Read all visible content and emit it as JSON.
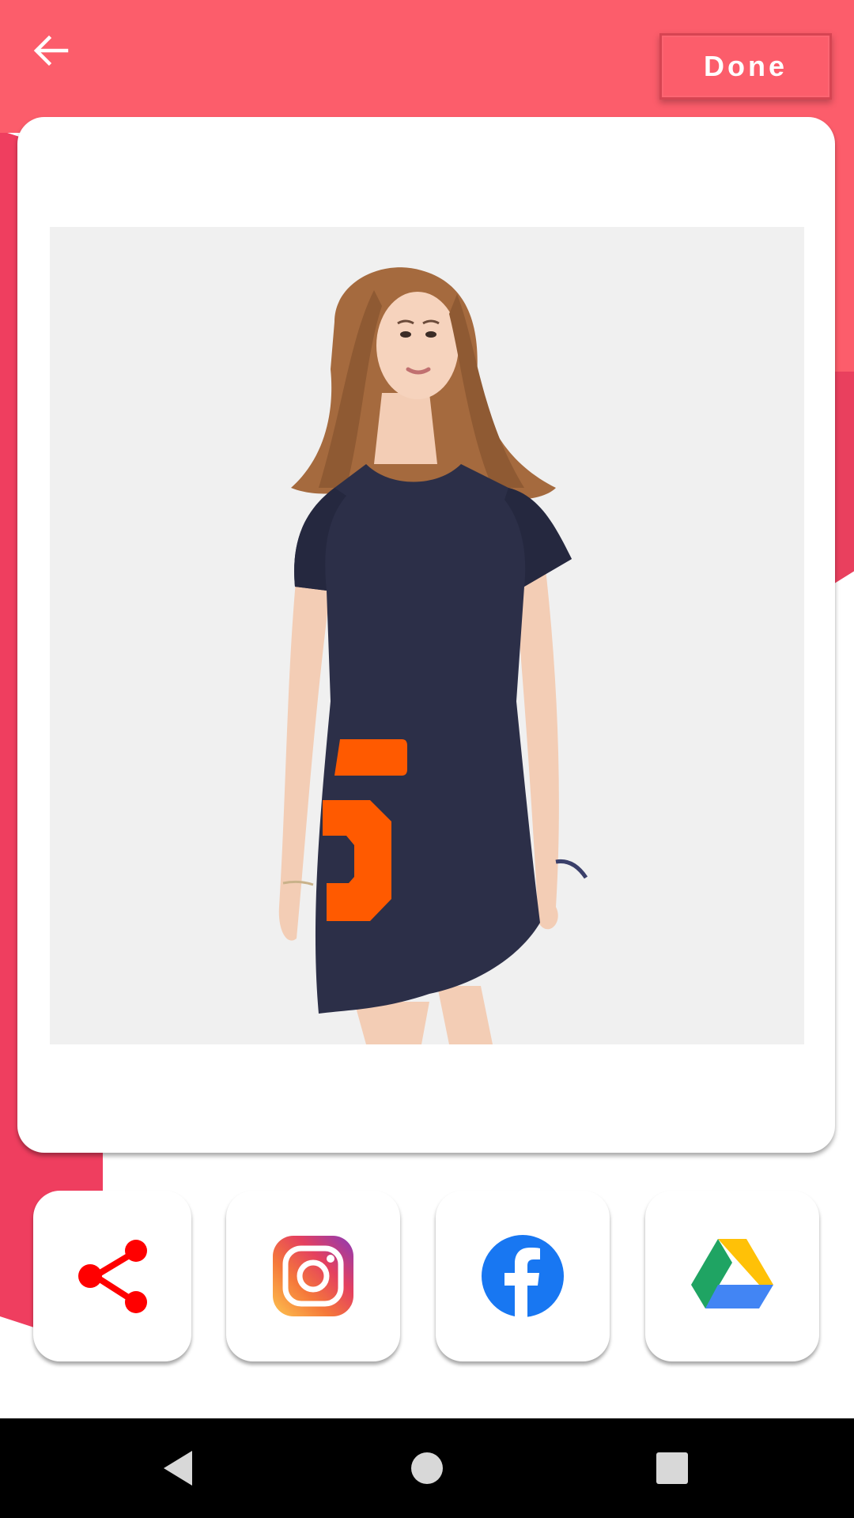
{
  "header": {
    "back_icon": "arrow-left-icon",
    "done_label": "Done"
  },
  "colors": {
    "primary": "#fc5d6b",
    "primary_dark": "#ef3e5f",
    "share_red": "#ff0000",
    "facebook_blue": "#1877f2",
    "dress_navy": "#2c2f48",
    "number_orange": "#ff5a00"
  },
  "preview": {
    "subject": "model-wearing-navy-tshirt-dress",
    "print_text": "5"
  },
  "share": [
    {
      "id": "share",
      "icon": "share-icon"
    },
    {
      "id": "instagram",
      "icon": "instagram-icon"
    },
    {
      "id": "facebook",
      "icon": "facebook-icon"
    },
    {
      "id": "drive",
      "icon": "google-drive-icon"
    }
  ],
  "navbar": {
    "back_icon": "nav-back-icon",
    "home_icon": "nav-home-icon",
    "recents_icon": "nav-recents-icon"
  }
}
